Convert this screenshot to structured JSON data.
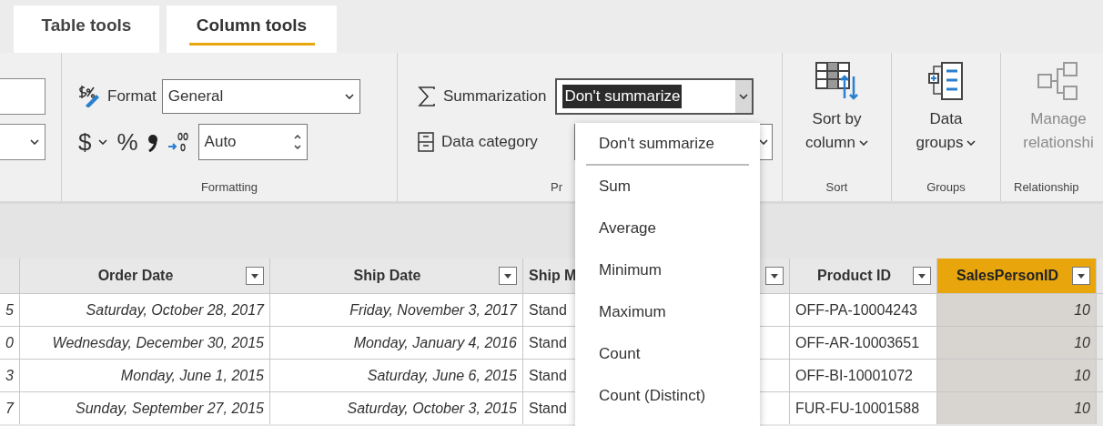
{
  "tabs": [
    {
      "label": "Table tools",
      "selected": false
    },
    {
      "label": "Column tools",
      "selected": true
    }
  ],
  "ribbon": {
    "formatting": {
      "format_label": "Format",
      "format_value": "General",
      "currency_symbol": "$",
      "percent_symbol": "%",
      "decimal_places": "Auto",
      "group_label": "Formatting"
    },
    "properties": {
      "summarization_label": "Summarization",
      "summarization_value": "Don't summarize",
      "data_category_label": "Data category",
      "group_label": "Pr"
    },
    "sort": {
      "button_lines": [
        "Sort by",
        "column"
      ],
      "group_label": "Sort"
    },
    "groups": {
      "button_lines": [
        "Data",
        "groups"
      ],
      "group_label": "Groups"
    },
    "relationships": {
      "button_lines": [
        "Manage",
        "relationshi"
      ],
      "disabled": true,
      "group_label": "Relationship"
    }
  },
  "summarization_menu": {
    "options": [
      "Don't summarize",
      "Sum",
      "Average",
      "Minimum",
      "Maximum",
      "Count",
      "Count (Distinct)"
    ]
  },
  "table": {
    "columns": [
      {
        "kind": "number",
        "selected": false
      },
      {
        "label": "Order Date",
        "kind": "date",
        "selected": false
      },
      {
        "label": "Ship Date",
        "kind": "date",
        "selected": false
      },
      {
        "label": "Ship M",
        "kind": "text",
        "selected": false
      },
      {
        "kind": "text",
        "selected": false
      },
      {
        "label": "Product ID",
        "kind": "text",
        "selected": false
      },
      {
        "label": "SalesPersonID",
        "kind": "number",
        "selected": true
      }
    ],
    "rows": [
      [
        "5",
        "Saturday, October 28, 2017",
        "Friday, November 3, 2017",
        "Stand",
        "",
        "OFF-PA-10004243",
        "10"
      ],
      [
        "0",
        "Wednesday, December 30, 2015",
        "Monday, January 4, 2016",
        "Stand",
        "",
        "OFF-AR-10003651",
        "10"
      ],
      [
        "3",
        "Monday, June 1, 2015",
        "Saturday, June 6, 2015",
        "Stand",
        "",
        "OFF-BI-10001072",
        "10"
      ],
      [
        "7",
        "Sunday, September 27, 2015",
        "Saturday, October 3, 2015",
        "Stand",
        "",
        "FUR-FU-10001588",
        "10"
      ]
    ]
  }
}
